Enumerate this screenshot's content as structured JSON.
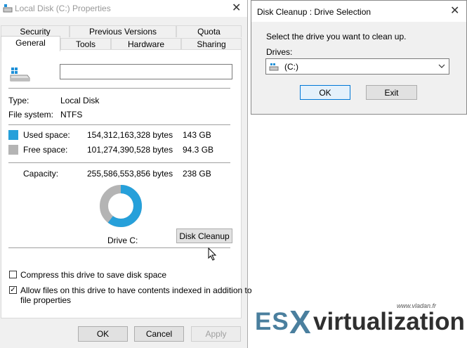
{
  "properties_window": {
    "title": "Local Disk (C:) Properties",
    "tabs_row1": [
      "Security",
      "Previous Versions",
      "Quota"
    ],
    "tabs_row2": [
      "General",
      "Tools",
      "Hardware",
      "Sharing"
    ],
    "active_tab": "General",
    "drive_name_value": "",
    "type_label": "Type:",
    "type_value": "Local Disk",
    "fs_label": "File system:",
    "fs_value": "NTFS",
    "used_label": "Used space:",
    "used_bytes": "154,312,163,328 bytes",
    "used_size": "143 GB",
    "free_label": "Free space:",
    "free_bytes": "101,274,390,528 bytes",
    "free_size": "94.3 GB",
    "capacity_label": "Capacity:",
    "capacity_bytes": "255,586,553,856 bytes",
    "capacity_size": "238 GB",
    "drive_label": "Drive C:",
    "disk_cleanup_button": "Disk Cleanup",
    "compress_label": "Compress this drive to save disk space",
    "compress_checked": false,
    "index_label_line1": "Allow files on this drive to have contents indexed in addition to",
    "index_label_line2": "file properties",
    "index_checked": true,
    "ok_button": "OK",
    "cancel_button": "Cancel",
    "apply_button": "Apply",
    "colors": {
      "used": "#26a0da",
      "free": "#b4b4b4"
    },
    "used_fraction": 0.604
  },
  "cleanup_dialog": {
    "title": "Disk Cleanup : Drive Selection",
    "instruction": "Select the drive you want to clean up.",
    "drives_label": "Drives:",
    "selected_drive": "(C:)",
    "ok_button": "OK",
    "exit_button": "Exit"
  },
  "watermark": {
    "url": "www.vladan.fr",
    "es": "ES",
    "x": "X",
    "rest": "virtualization"
  }
}
